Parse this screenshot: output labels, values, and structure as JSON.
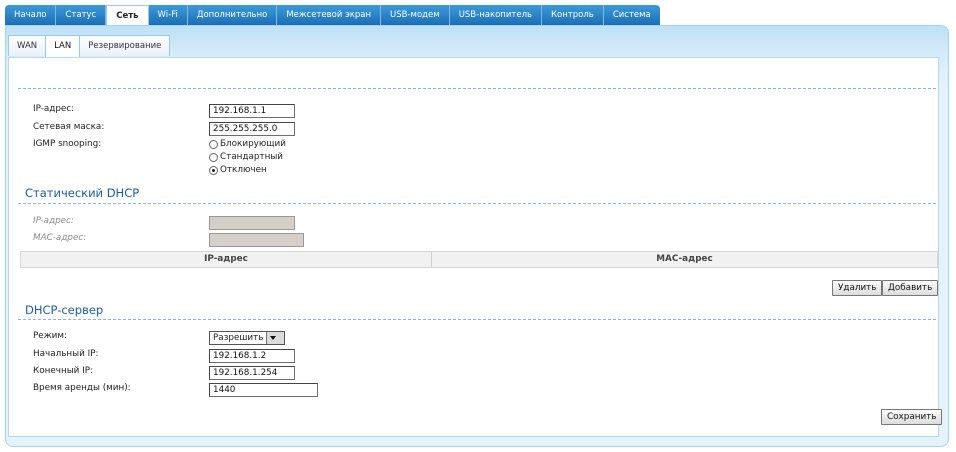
{
  "topnav": {
    "tabs": [
      "Начало",
      "Статус",
      "Сеть",
      "Wi-Fi",
      "Дополнительно",
      "Межсетевой экран",
      "USB-модем",
      "USB-накопитель",
      "Контроль",
      "Система"
    ],
    "active": "Сеть"
  },
  "subnav": {
    "tabs": [
      "WAN",
      "LAN",
      "Резервирование"
    ],
    "active": "LAN"
  },
  "lan": {
    "ip_label": "IP-адрес:",
    "ip_value": "192.168.1.1",
    "mask_label": "Сетевая маска:",
    "mask_value": "255.255.255.0",
    "igmp_label": "IGMP snooping:",
    "igmp_options": [
      "Блокирующий",
      "Стандартный",
      "Отключен"
    ],
    "igmp_selected": "Отключен"
  },
  "static_dhcp": {
    "title": "Статический DHCP",
    "ip_label": "IP-адрес:",
    "mac_label": "MAC-адрес:",
    "table_headers": [
      "IP-адрес",
      "MAC-адрес"
    ],
    "delete_label": "Удалить",
    "add_label": "Добавить"
  },
  "dhcp_server": {
    "title": "DHCP-сервер",
    "mode_label": "Режим:",
    "mode_value": "Разрешить",
    "start_label": "Начальный IP:",
    "start_value": "192.168.1.2",
    "end_label": "Конечный IP:",
    "end_value": "192.168.1.254",
    "lease_label": "Время аренды (мин):",
    "lease_value": "1440",
    "save_label": "Сохранить"
  }
}
